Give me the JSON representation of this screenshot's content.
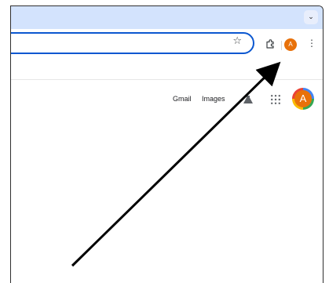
{
  "browser": {
    "tab_menu_icon": "chevron-down-icon",
    "toolbar": {
      "bookmark_icon": "star-icon",
      "extensions_icon": "puzzle-icon",
      "profile_initial": "A",
      "menu_icon": "vertical-dots-icon"
    }
  },
  "google_header": {
    "gmail_label": "Gmail",
    "images_label": "Images",
    "labs_icon": "flask-icon",
    "apps_icon": "grid-icon",
    "profile_initial": "A"
  },
  "annotation": {
    "arrow_color": "#000000"
  },
  "colors": {
    "tabstrip": "#d3e3fd",
    "omnibox_border": "#0b57d0",
    "profile_orange": "#e8710a"
  }
}
